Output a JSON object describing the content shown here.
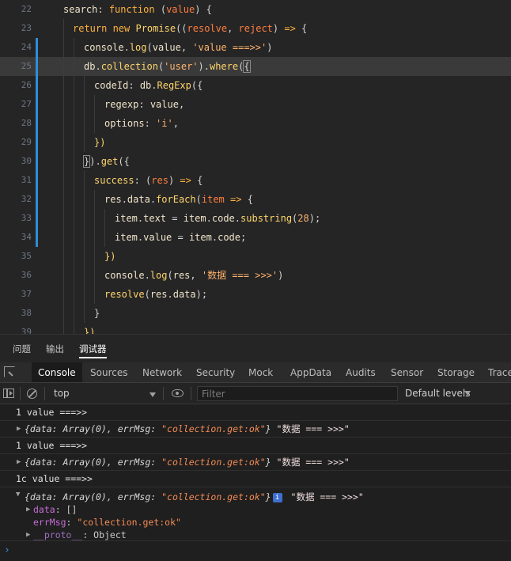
{
  "editor": {
    "lines": [
      {
        "num": "22",
        "text": "search: function (value) {"
      },
      {
        "num": "23",
        "text": "return new Promise((resolve, reject) => {"
      },
      {
        "num": "24",
        "text": "console.log(value, 'value ===>>')"
      },
      {
        "num": "25",
        "text": "db.collection('user').where({"
      },
      {
        "num": "26",
        "text": "codeId: db.RegExp({"
      },
      {
        "num": "27",
        "text": "regexp: value,"
      },
      {
        "num": "28",
        "text": "options: 'i',"
      },
      {
        "num": "29",
        "text": "})"
      },
      {
        "num": "30",
        "text": "}).get({"
      },
      {
        "num": "31",
        "text": "success: (res) => {"
      },
      {
        "num": "32",
        "text": "res.data.forEach(item => {"
      },
      {
        "num": "33",
        "text": "item.text = item.code.substring(28);"
      },
      {
        "num": "34",
        "text": "item.value = item.code;"
      },
      {
        "num": "35",
        "text": "})"
      },
      {
        "num": "36",
        "text": "console.log(res, '数据 === >>>')"
      },
      {
        "num": "37",
        "text": "resolve(res.data);"
      },
      {
        "num": "38",
        "text": "}"
      },
      {
        "num": "39",
        "text": "})"
      }
    ]
  },
  "panel_tabs": {
    "problems": "问题",
    "output": "输出",
    "debugger": "调试器"
  },
  "devtools_tabs": [
    "Console",
    "Sources",
    "Network",
    "Security",
    "Mock",
    "AppData",
    "Audits",
    "Sensor",
    "Storage",
    "Trace"
  ],
  "toolbar": {
    "context": "top",
    "filter_placeholder": "Filter",
    "levels": "Default levels"
  },
  "console": {
    "log1": "1 value ===>>",
    "log2": "1 value ===>>",
    "log3": "1c value ===>>",
    "obj_prefix": "{data: Array(0), errMsg: ",
    "obj_errmsg": "\"collection.get:ok\"",
    "obj_suffix": "}",
    "label": "\"数据 === >>>\"",
    "info_badge": "i",
    "expanded": {
      "data_key": "data",
      "data_val": ": []",
      "errmsg_key": "errMsg",
      "errmsg_val": "\"collection.get:ok\"",
      "proto_key": "__proto__",
      "proto_val": ": Object"
    },
    "prompt": "›"
  }
}
